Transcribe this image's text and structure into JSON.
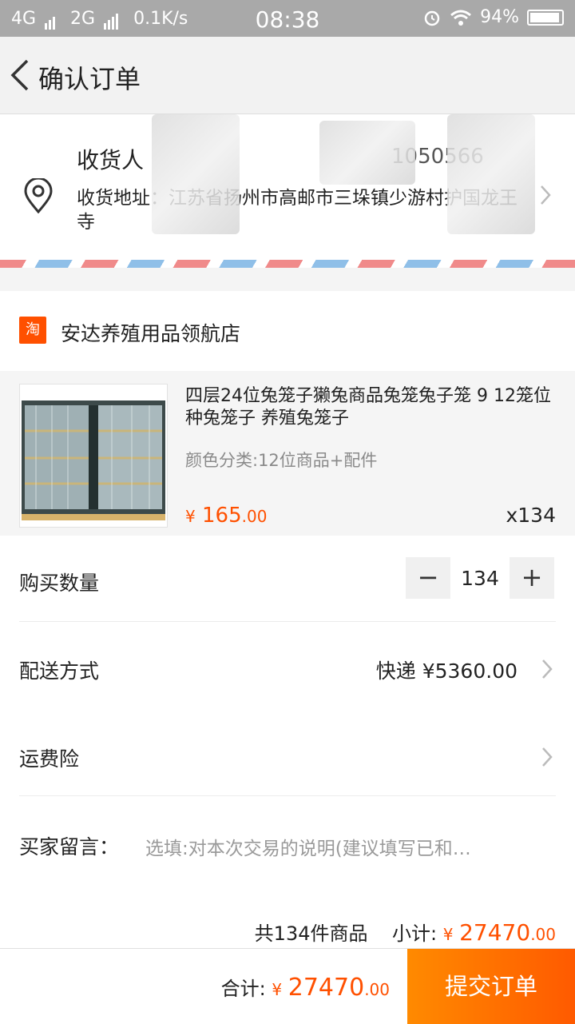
{
  "status_bar": {
    "network": "4G",
    "network2": "2G",
    "speed": "0.1K/s",
    "time": "08:38",
    "battery": "94%"
  },
  "nav": {
    "title": "确认订单"
  },
  "address": {
    "name_label": "收货人",
    "phone": "1050566",
    "address_text": "收货地址：江苏省扬州市高邮市三垛镇少游村护国龙王寺"
  },
  "shop": {
    "logo_text": "淘",
    "name": "安达养殖用品领航店"
  },
  "item": {
    "title": "四层24位兔笼子獭兔商品兔笼兔子笼 9 12笼位种兔笼子 养殖兔笼子",
    "sku": "颜色分类:12位商品+配件",
    "currency": "¥",
    "price_int": "165",
    "price_dec": ".00",
    "quantity": "x134"
  },
  "quantity_row": {
    "label": "购买数量",
    "minus": "−",
    "value": "134",
    "plus": "+"
  },
  "delivery_row": {
    "label": "配送方式",
    "value": "快递 ¥5360.00"
  },
  "insurance_row": {
    "label": "运费险"
  },
  "message_row": {
    "label": "买家留言：",
    "placeholder": "选填:对本次交易的说明(建议填写已和…"
  },
  "summary": {
    "count_text": "共134件商品",
    "subtotal_label": "小计:",
    "currency": "¥",
    "subtotal_int": "27470",
    "subtotal_dec": ".00"
  },
  "bottom_bar": {
    "total_label": "合计:",
    "currency": "¥",
    "total_int": "27470",
    "total_dec": ".00",
    "submit": "提交订单"
  },
  "colors": {
    "accent": "#ff5000",
    "submit_gradient_start": "#ff8a00",
    "status_bar": "#a9a9a9"
  }
}
